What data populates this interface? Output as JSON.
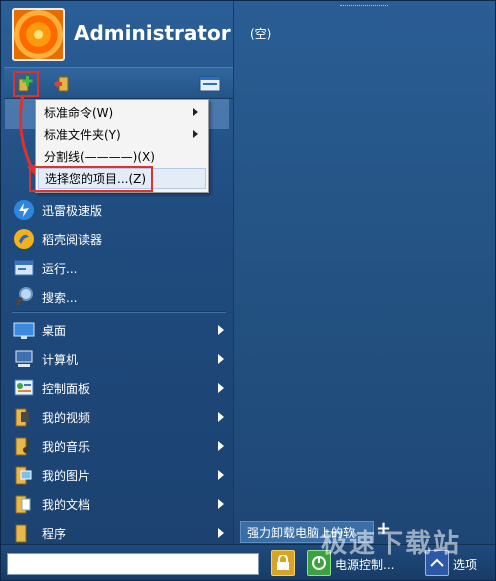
{
  "user": {
    "name": "Administrator"
  },
  "toolbar": {
    "add_icon": "add-item-icon",
    "exit_icon": "exit-door-icon",
    "view_icon": "window-icon"
  },
  "context_menu": {
    "items": [
      {
        "label": "标准命令(W)",
        "has_submenu": true
      },
      {
        "label": "标准文件夹(Y)",
        "has_submenu": true
      },
      {
        "label": "分割线(————)(X)",
        "has_submenu": false
      },
      {
        "label": "选择您的项目...(Z)",
        "has_submenu": false,
        "highlighted": true
      }
    ]
  },
  "menu_items": [
    {
      "label": "迅雷极速版",
      "icon": "thunder-icon",
      "submenu": false
    },
    {
      "label": "稻壳阅读器",
      "icon": "reader-icon",
      "submenu": false
    },
    {
      "label": "运行...",
      "icon": "run-icon",
      "submenu": false
    },
    {
      "label": "搜索...",
      "icon": "search-icon",
      "submenu": false
    },
    {
      "label": "桌面",
      "icon": "desktop-icon",
      "submenu": true
    },
    {
      "label": "计算机",
      "icon": "computer-icon",
      "submenu": true
    },
    {
      "label": "控制面板",
      "icon": "control-panel-icon",
      "submenu": true
    },
    {
      "label": "我的视频",
      "icon": "folder-video-icon",
      "submenu": true
    },
    {
      "label": "我的音乐",
      "icon": "folder-music-icon",
      "submenu": true
    },
    {
      "label": "我的图片",
      "icon": "folder-pictures-icon",
      "submenu": true
    },
    {
      "label": "我的文档",
      "icon": "folder-documents-icon",
      "submenu": true
    },
    {
      "label": "程序",
      "icon": "folder-programs-icon",
      "submenu": true
    }
  ],
  "right_panel": {
    "empty_label": "(空)",
    "tab_label": "强力卸载电脑上的软",
    "add_tab": "+"
  },
  "bottom": {
    "search_value": "",
    "power_label": "电源控制...",
    "switch_label": "选项"
  },
  "watermark": "极速下载站",
  "colors": {
    "highlight_box": "#e0302f",
    "menu_bg": "#22507f",
    "accent": "#5e8cc0"
  }
}
